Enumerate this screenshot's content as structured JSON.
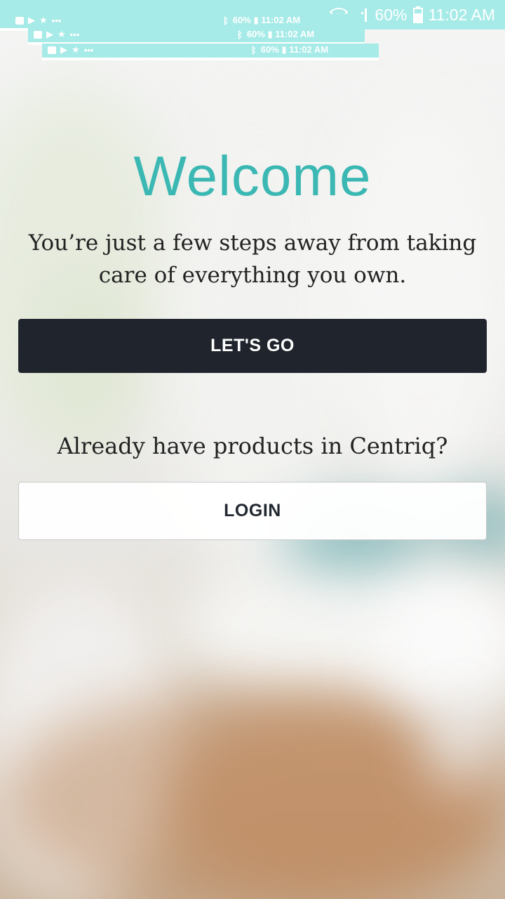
{
  "status_bar": {
    "battery": "60%",
    "time": "11:02 AM",
    "ghost_text": "60% ▮ 11:02 AM",
    "accent_color": "#a6ebe7"
  },
  "welcome": {
    "title": "Welcome",
    "subtitle": "You’re just a few steps away from taking care of everything you own.",
    "title_color": "#3bb8b3"
  },
  "actions": {
    "primary_label": "LET'S GO",
    "primary_color": "#20252d",
    "login_prompt": "Already have products in Centriq?",
    "login_label": "LOGIN"
  },
  "icons": [
    "wifi-icon",
    "signal-icon",
    "battery-icon",
    "image-icon",
    "play-icon",
    "star-icon",
    "more-icon",
    "bluetooth-icon"
  ]
}
